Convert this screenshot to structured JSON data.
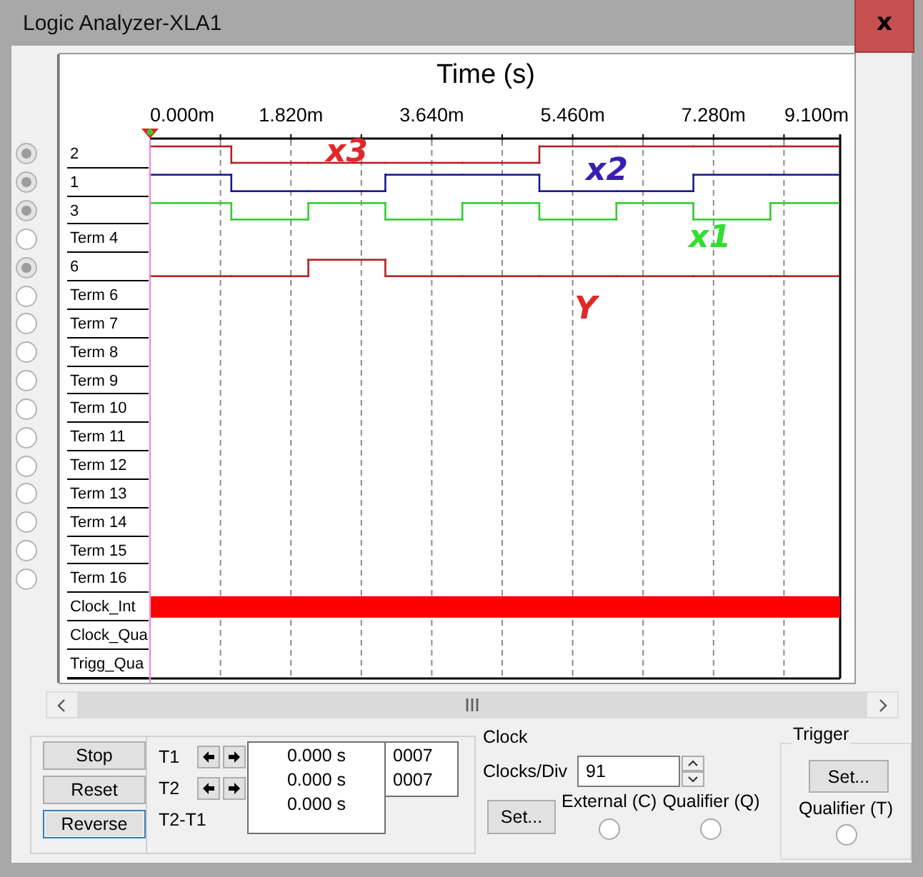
{
  "window": {
    "title": "Logic Analyzer-XLA1",
    "close_label": "x"
  },
  "plot": {
    "title": "Time (s)",
    "ticks": [
      "0.000m",
      "1.820m",
      "3.640m",
      "5.460m",
      "7.280m",
      "9.100m"
    ],
    "channels": [
      {
        "label": "2",
        "connected": true,
        "color": "#b22222",
        "high": [
          true,
          false,
          false,
          false,
          false,
          true,
          true,
          true,
          true
        ]
      },
      {
        "label": "1",
        "connected": true,
        "color": "#1a1a8c",
        "high": [
          true,
          false,
          false,
          true,
          true,
          false,
          false,
          true,
          true
        ]
      },
      {
        "label": "3",
        "connected": true,
        "color": "#33cc33",
        "high": [
          true,
          false,
          true,
          false,
          true,
          false,
          true,
          false,
          true
        ]
      },
      {
        "label": "Term 4",
        "connected": false
      },
      {
        "label": "6",
        "connected": true,
        "color": "#b22222",
        "high": [
          false,
          false,
          true,
          false,
          false,
          false,
          false,
          false,
          false
        ]
      },
      {
        "label": "Term 6",
        "connected": false
      },
      {
        "label": "Term 7",
        "connected": false
      },
      {
        "label": "Term 8",
        "connected": false
      },
      {
        "label": "Term 9",
        "connected": false
      },
      {
        "label": "Term 10",
        "connected": false
      },
      {
        "label": "Term 11",
        "connected": false
      },
      {
        "label": "Term 12",
        "connected": false
      },
      {
        "label": "Term 13",
        "connected": false
      },
      {
        "label": "Term 14",
        "connected": false
      },
      {
        "label": "Term 15",
        "connected": false
      },
      {
        "label": "Term 16",
        "connected": false
      }
    ],
    "clock_rows": [
      {
        "label": "Clock_Int",
        "filled": true
      },
      {
        "label": "Clock_Qua",
        "filled": false
      },
      {
        "label": "Trigg_Qua",
        "filled": false
      }
    ],
    "annotations": [
      {
        "text": "x3",
        "color": "#e02828"
      },
      {
        "text": "x2",
        "color": "#3a1eb4"
      },
      {
        "text": "x1",
        "color": "#33dd33"
      },
      {
        "text": "Y",
        "color": "#e02828"
      }
    ]
  },
  "controls": {
    "buttons": [
      {
        "label": "Stop",
        "focused": false
      },
      {
        "label": "Reset",
        "focused": false
      },
      {
        "label": "Reverse",
        "focused": true
      }
    ],
    "cursors": [
      {
        "label": "T1",
        "time": "0.000 s",
        "hex": "0007"
      },
      {
        "label": "T2",
        "time": "0.000 s",
        "hex": "0007"
      },
      {
        "label": "T2-T1",
        "time": "0.000 s"
      }
    ],
    "clock": {
      "title": "Clock",
      "clocks_div_label": "Clocks/Div",
      "clocks_div": "91",
      "set_button": "Set...",
      "external_label": "External (C)",
      "external_selected": false,
      "qualifier_label": "Qualifier (Q)",
      "qualifier_selected": false
    },
    "trigger": {
      "title": "Trigger",
      "set_button": "Set...",
      "qualifier_label": "Qualifier (T)",
      "qualifier_selected": false
    }
  }
}
